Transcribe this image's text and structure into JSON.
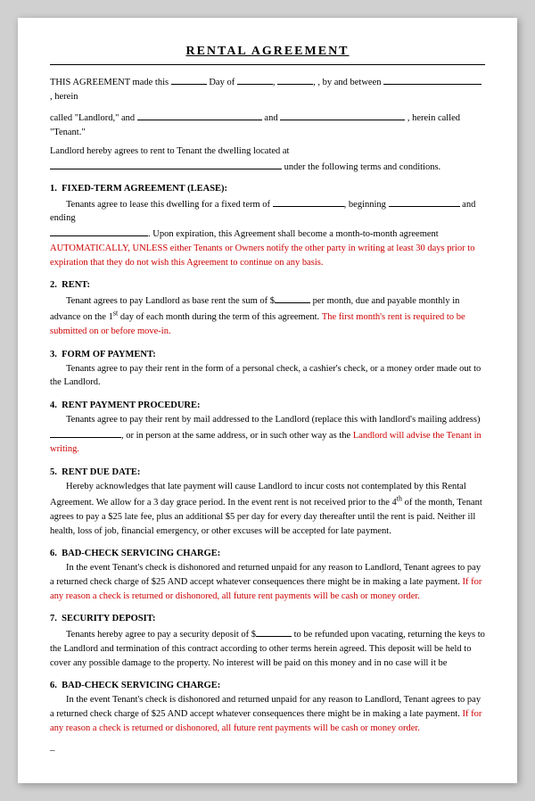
{
  "title": "RENTAL AGREEMENT",
  "intro": {
    "line1": "THIS AGREEMENT made this",
    "line1b": "Day of",
    "line1c": ", by and between",
    "line1d": ", herein",
    "line2a": "called \"Landlord,\" and",
    "line2b": "and",
    "line2c": ", herein called \"Tenant.\"",
    "line3a": "Landlord hereby agrees to rent to Tenant the dwelling located at",
    "line3b": "under the following terms and conditions."
  },
  "sections": [
    {
      "number": "1.",
      "title": "FIXED-TERM AGREEMENT (LEASE):",
      "body_parts": [
        {
          "text": "Tenants agree to lease this dwelling for a fixed term of ",
          "type": "normal"
        },
        {
          "text": "",
          "type": "blank",
          "size": "md"
        },
        {
          "text": ", beginning ",
          "type": "normal"
        },
        {
          "text": "",
          "type": "blank",
          "size": "md"
        },
        {
          "text": "and ending",
          "type": "normal"
        },
        {
          "text": "",
          "type": "blank_newline",
          "size": "lg"
        },
        {
          "text": ". Upon expiration, this Agreement shall become a month-to-month agreement",
          "type": "normal"
        },
        {
          "text": "AUTOMATICALLY, UNLESS either Tenants or Owners notify the other party in ",
          "type": "red"
        },
        {
          "text": "writing",
          "type": "red"
        },
        {
          "text": " at least 30 days prior to expiration that they do not wish this Agreement to continue on any basis.",
          "type": "red"
        }
      ]
    },
    {
      "number": "2.",
      "title": "RENT:",
      "body": "Tenant agrees to pay Landlord as base rent the sum of $_______ per month, due and payable monthly in advance on the 1st day of each month during the term of this agreement. The first month's rent is required to be submitted on or before move-in."
    },
    {
      "number": "3.",
      "title": "FORM OF PAYMENT:",
      "body": "Tenants agree to pay their rent in the form of a personal check, a cashier's check, or a money order made out to the Landlord."
    },
    {
      "number": "4.",
      "title": "RENT PAYMENT PROCEDURE:",
      "body": "Tenants agree to pay their rent by mail addressed to the Landlord (replace this with landlord's mailing address)_____________, or in person at the same address, or in such other way as the Landlord will advise the Tenant in writing."
    },
    {
      "number": "5.",
      "title": "RENT DUE DATE:",
      "body": "Hereby acknowledges that late payment will cause Landlord to incur costs not contemplated by this Rental Agreement. We allow for a 3 day grace period. In the event rent is not received prior to the 4th of the month, Tenant agrees to pay a $25 late fee, plus an additional $5 per day for every day thereafter until the rent is paid. Neither ill health, loss of job, financial emergency, or other excuses will be accepted for late payment."
    },
    {
      "number": "6.",
      "title": "BAD-CHECK SERVICING CHARGE:",
      "body": "In the event Tenant's check is dishonored and returned unpaid for any reason to Landlord, Tenant agrees to pay a returned check charge of $25 AND accept whatever consequences there might be in making a late payment. If for any reason a check is returned or dishonored, all future rent payments will be cash or money order."
    },
    {
      "number": "7.",
      "title": "SECURITY DEPOSIT:",
      "body": "Tenants hereby agree to pay a security deposit of $_______ to be refunded upon vacating, returning the keys to the Landlord and termination of this contract according to other terms herein agreed. This deposit will be held to cover any possible damage to the property. No interest will be paid on this money and in no case will it be"
    },
    {
      "number": "6.",
      "title": "BAD-CHECK SERVICING CHARGE:",
      "body": "In the event Tenant's check is dishonored and returned unpaid for any reason to Landlord, Tenant agrees to pay a returned check charge of $25 AND accept whatever consequences there might be in making a late payment. If for any reason a check is returned or dishonored, all future rent payments will be cash or money order."
    }
  ],
  "footer_dash": "–"
}
